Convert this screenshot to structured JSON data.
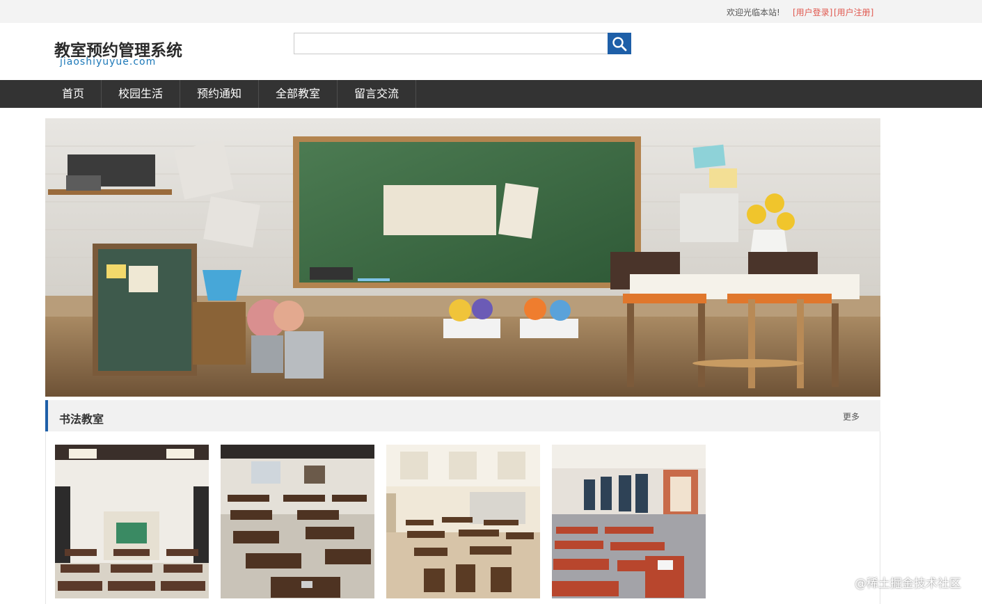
{
  "topbar": {
    "welcome": "欢迎光临本站!",
    "login_label": "[用户登录]",
    "register_label": "[用户注册]"
  },
  "header": {
    "title": "教室预约管理系统",
    "subtitle": "jiaoshiyuyue.com",
    "search_placeholder": "",
    "search_icon": "search-icon"
  },
  "nav": {
    "items": [
      {
        "label": "首页"
      },
      {
        "label": "校园生活"
      },
      {
        "label": "预约通知"
      },
      {
        "label": "全部教室"
      },
      {
        "label": "留言交流"
      }
    ]
  },
  "section": {
    "title": "书法教室",
    "more_label": "更多"
  },
  "watermark": "@稀土掘金技术社区",
  "colors": {
    "accent": "#1e5fa8",
    "nav_bg": "#333333",
    "link_red": "#e0584f",
    "chalkboard": "#3f6b45"
  }
}
